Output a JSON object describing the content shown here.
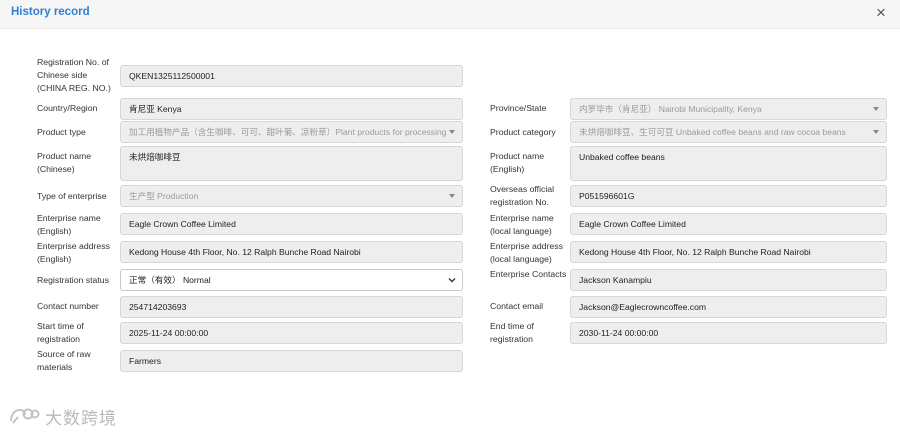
{
  "modal": {
    "title": "History record",
    "close_symbol": "×"
  },
  "left": {
    "reg_no": {
      "label": "Registration No. of Chinese side (CHINA REG. NO.)",
      "value": "QKEN1325112500001"
    },
    "country": {
      "label": "Country/Region",
      "value": "肯尼亚 Kenya"
    },
    "product_type": {
      "label": "Product type",
      "value": "加工用植物产品（含生咖啡、可可、甜叶菊、凉粉草）Plant products for processing"
    },
    "product_name_cn": {
      "label": "Product name (Chinese)",
      "value": "未烘焙咖啡豆"
    },
    "enterprise_type": {
      "label": "Type of enterprise",
      "value": "生产型 Production"
    },
    "enterprise_name_en": {
      "label": "Enterprise name (English)",
      "value": "Eagle Crown Coffee Limited"
    },
    "enterprise_addr_en": {
      "label": "Enterprise address (English)",
      "value": "Kedong House 4th Floor, No. 12 Ralph Bunche Road Nairobi"
    },
    "reg_status": {
      "label": "Registration status",
      "value": "正常（有效） Normal"
    },
    "contact_number": {
      "label": "Contact number",
      "value": "254714203693"
    },
    "start_time": {
      "label": "Start time of registration",
      "value": "2025-11-24 00:00:00"
    },
    "raw_source": {
      "label": "Source of raw materials",
      "value": "Farmers"
    }
  },
  "right": {
    "province": {
      "label": "Province/State",
      "value": "内罗毕市（肯尼亚） Nairobi Municipality, Kenya"
    },
    "product_category": {
      "label": "Product category",
      "value": "未烘焙咖啡豆、生可可豆 Unbaked coffee beans and raw cocoa beans"
    },
    "product_name_en": {
      "label": "Product name (English)",
      "value": "Unbaked coffee beans"
    },
    "overseas_reg": {
      "label": "Overseas official registration No.",
      "value": "P051596601G"
    },
    "enterprise_name_local": {
      "label": "Enterprise name (local language)",
      "value": "Eagle Crown Coffee Limited"
    },
    "enterprise_addr_local": {
      "label": "Enterprise address (local language)",
      "value": "Kedong House 4th Floor, No. 12 Ralph Bunche Road Nairobi"
    },
    "contacts": {
      "label": "Enterprise Contacts",
      "value": "Jackson Kanampiu"
    },
    "contact_email": {
      "label": "Contact email",
      "value": "Jackson@Eaglecrowncoffee.com"
    },
    "end_time": {
      "label": "End time of registration",
      "value": "2030-11-24 00:00:00"
    }
  },
  "watermark": {
    "text": "大数跨境"
  },
  "colors": {
    "title": "#2f7fd0",
    "field_bg": "#eeeeee",
    "field_border": "#d6d6d6"
  }
}
